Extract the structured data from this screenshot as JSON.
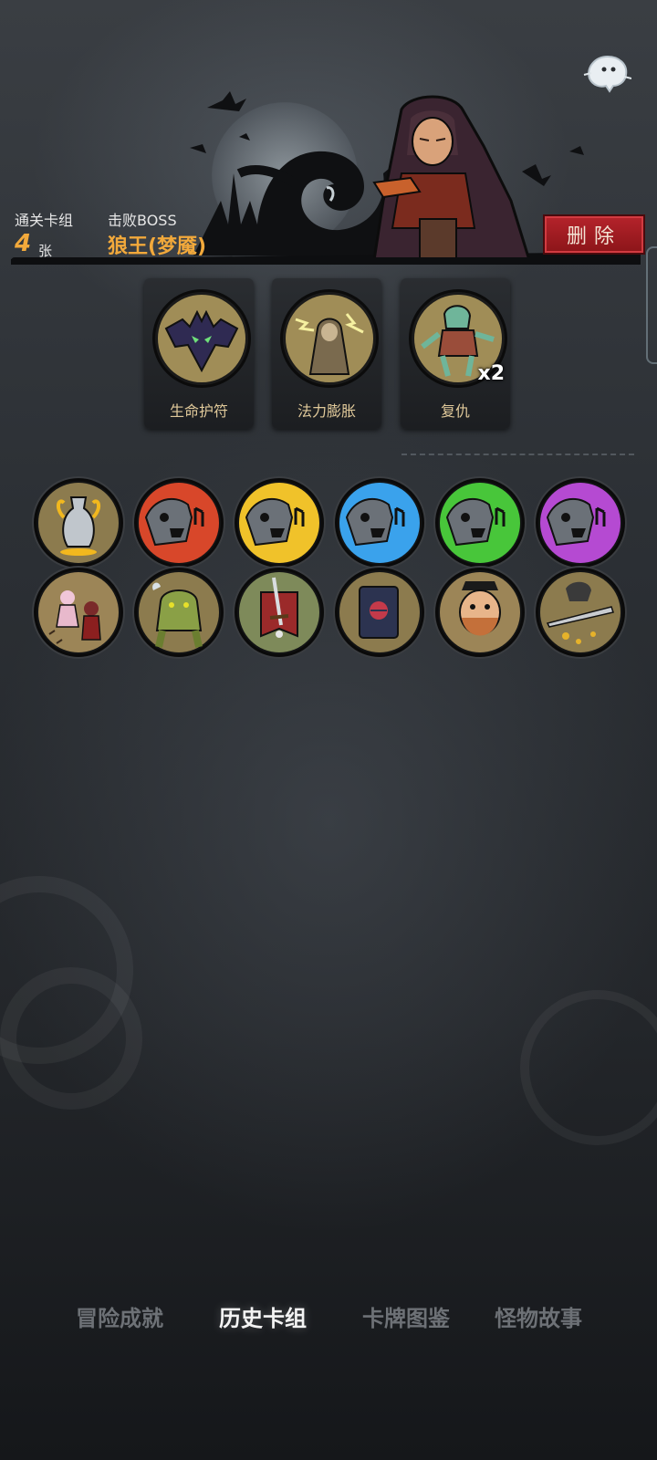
{
  "header": {
    "deck_label": "通关卡组",
    "deck_count": "4",
    "deck_unit": "张",
    "boss_label": "击败BOSS",
    "boss_name": "狼王(梦魇)",
    "delete_label": "删除"
  },
  "relics": [
    {
      "name": "生命护符",
      "icon": "bat-amulet-icon"
    },
    {
      "name": "法力膨胀",
      "icon": "hooded-mage-icon"
    },
    {
      "name": "复仇",
      "icon": "zombie-icon",
      "multiplier": "x2"
    }
  ],
  "cards": [
    {
      "icon": "golden-vase-icon",
      "color": "#c79b2e"
    },
    {
      "icon": "singing-skull-red-icon",
      "color": "#d8472a"
    },
    {
      "icon": "singing-skull-yellow-icon",
      "color": "#f0c22a"
    },
    {
      "icon": "singing-skull-blue-icon",
      "color": "#3aa2ec"
    },
    {
      "icon": "singing-skull-green-icon",
      "color": "#48c63a"
    },
    {
      "icon": "singing-skull-purple-icon",
      "color": "#b54ad2"
    },
    {
      "icon": "dancing-couple-icon",
      "color": "#b7844a"
    },
    {
      "icon": "green-ogre-icon",
      "color": "#8aa046"
    },
    {
      "icon": "sword-banner-icon",
      "color": "#9b2a2a"
    },
    {
      "icon": "spell-book-icon",
      "color": "#2c3350"
    },
    {
      "icon": "pirate-face-icon",
      "color": "#c4703a"
    },
    {
      "icon": "thrown-dagger-icon",
      "color": "#cfa23b"
    }
  ],
  "nav": {
    "tabs": [
      "冒险成就",
      "历史卡组",
      "卡牌图鉴",
      "怪物故事"
    ],
    "active_index": 1
  },
  "colors": {
    "accent_orange": "#f2a93b",
    "delete_red": "#a61c23",
    "relic_label": "#e0c99a"
  }
}
